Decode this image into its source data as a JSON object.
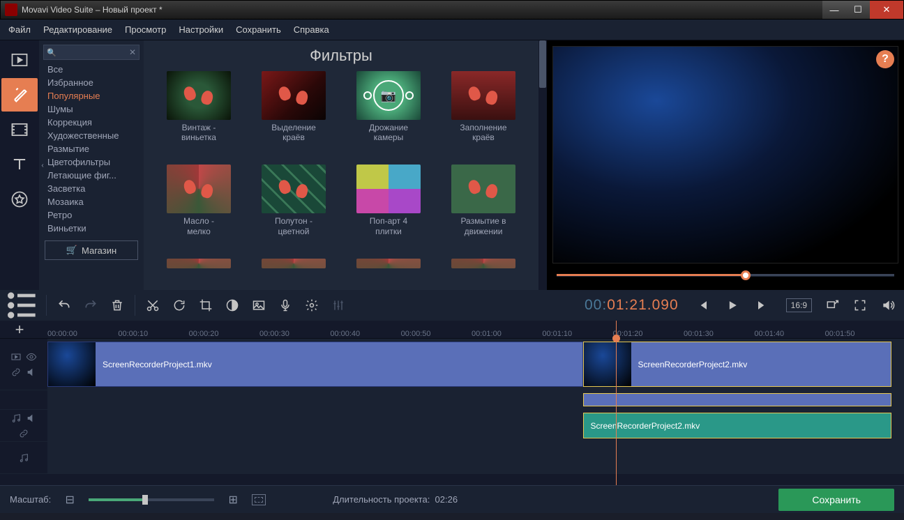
{
  "window": {
    "title": "Movavi Video Suite – Новый проект *"
  },
  "menu": {
    "file": "Файл",
    "edit": "Редактирование",
    "view": "Просмотр",
    "settings": "Настройки",
    "save": "Сохранить",
    "help": "Справка"
  },
  "panel": {
    "title": "Фильтры",
    "search_placeholder": "",
    "store": "Магазин",
    "categories": [
      "Все",
      "Избранное",
      "Популярные",
      "Шумы",
      "Коррекция",
      "Художественные",
      "Размытие",
      "Цветофильтры",
      "Летающие фиг...",
      "Засветка",
      "Мозаика",
      "Ретро",
      "Виньетки"
    ],
    "selected_category": 2,
    "filters": [
      {
        "name": "Винтаж -\nвиньетка",
        "kind": "vintage"
      },
      {
        "name": "Выделение\nкраёв",
        "kind": "edge"
      },
      {
        "name": "Дрожание\nкамеры",
        "kind": "shake"
      },
      {
        "name": "Заполнение\nкраёв",
        "kind": "fill"
      },
      {
        "name": "Масло -\nмелко",
        "kind": "oil"
      },
      {
        "name": "Полутон -\nцветной",
        "kind": "half"
      },
      {
        "name": "Поп-арт 4\nплитки",
        "kind": "pop"
      },
      {
        "name": "Размытие в\nдвижении",
        "kind": "blur"
      }
    ]
  },
  "preview": {
    "progress_pct": 56
  },
  "toolbar": {
    "timecode_gray": "00:",
    "timecode_orange": "01:21.090",
    "ratio": "16:9"
  },
  "ruler": {
    "ticks": [
      "00:00:00",
      "00:00:10",
      "00:00:20",
      "00:00:30",
      "00:00:40",
      "00:00:50",
      "00:01:00",
      "00:01:10",
      "00:01:20",
      "00:01:30",
      "00:01:40",
      "00:01:50"
    ]
  },
  "tracks": {
    "playhead_pct": 67.0,
    "video": [
      {
        "name": "ScreenRecorderProject1.mkv",
        "left_pct": 0,
        "width_pct": 62.5,
        "selected": false
      },
      {
        "name": "ScreenRecorderProject2.mkv",
        "left_pct": 62.5,
        "width_pct": 36.0,
        "selected": true
      }
    ],
    "video2": [
      {
        "left_pct": 62.5,
        "width_pct": 36.0,
        "selected": true
      }
    ],
    "audio": [
      {
        "name": "ScreenRecorderProject2.mkv",
        "left_pct": 62.5,
        "width_pct": 36.0,
        "selected": true
      }
    ]
  },
  "footer": {
    "zoom_label": "Масштаб:",
    "duration_label": "Длительность проекта:",
    "duration_value": "02:26",
    "save": "Сохранить"
  }
}
